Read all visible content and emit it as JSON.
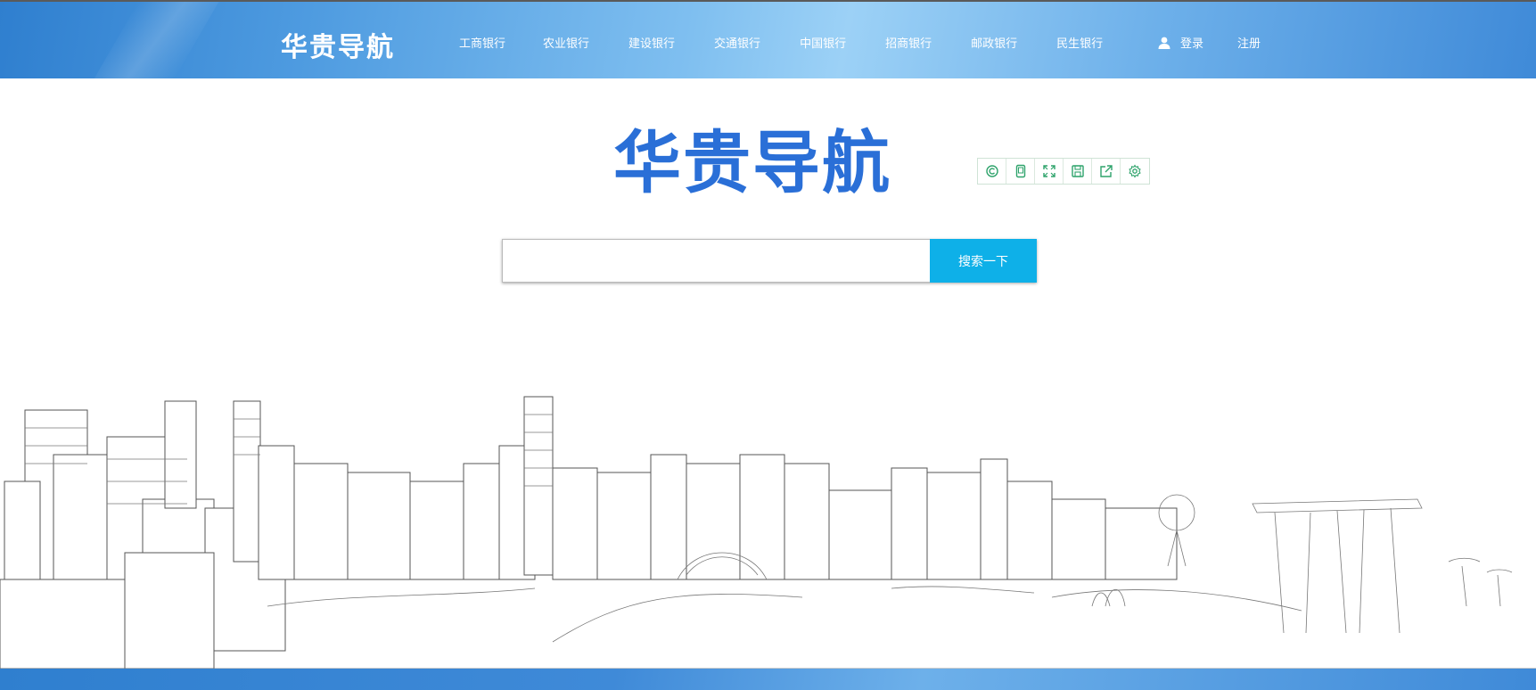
{
  "header": {
    "brand": "华贵导航",
    "nav": [
      "工商银行",
      "农业银行",
      "建设银行",
      "交通银行",
      "中国银行",
      "招商银行",
      "邮政银行",
      "民生银行"
    ],
    "login_label": "登录",
    "register_label": "注册"
  },
  "hero": {
    "logo_text": "华贵导航"
  },
  "search": {
    "value": "",
    "button_label": "搜索一下"
  },
  "toolbox": {
    "icons": [
      "refresh-icon",
      "mobile-icon",
      "fullscreen-icon",
      "save-icon",
      "share-icon",
      "settings-icon"
    ],
    "accent": "#2ea36b"
  },
  "colors": {
    "header": "#4e9be0",
    "logo": "#2a6fd7",
    "search_button": "#0eb0e8"
  }
}
